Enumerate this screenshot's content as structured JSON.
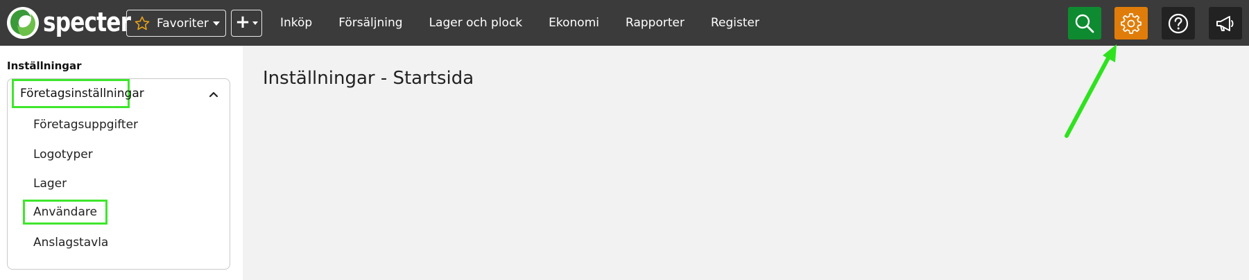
{
  "app": {
    "logo_text": "specter"
  },
  "topbar": {
    "favorites_label": "Favoriter",
    "add_label": "+",
    "nav": [
      {
        "label": "Inköp"
      },
      {
        "label": "Försäljning"
      },
      {
        "label": "Lager och plock"
      },
      {
        "label": "Ekonomi"
      },
      {
        "label": "Rapporter"
      },
      {
        "label": "Register"
      }
    ],
    "buttons": [
      {
        "icon": "search-icon",
        "color": "#0e8a30"
      },
      {
        "icon": "gear-icon",
        "color": "#e07d0a"
      },
      {
        "icon": "help-icon",
        "color": "#222222"
      },
      {
        "icon": "megaphone-icon",
        "color": "#222222"
      }
    ]
  },
  "sidebar": {
    "heading": "Inställningar",
    "section": {
      "label": "Företagsinställningar",
      "expanded": true,
      "items": [
        {
          "label": "Företagsuppgifter"
        },
        {
          "label": "Logotyper"
        },
        {
          "label": "Lager"
        },
        {
          "label": "Användare"
        },
        {
          "label": "Anslagstavla"
        }
      ]
    }
  },
  "main": {
    "title": "Inställningar - Startsida"
  },
  "colors": {
    "topbar_bg": "#3b3b3b",
    "highlight_green": "#3ee62c",
    "search_green": "#0e8a30",
    "settings_orange": "#e07d0a",
    "page_bg": "#f2f2f2"
  }
}
